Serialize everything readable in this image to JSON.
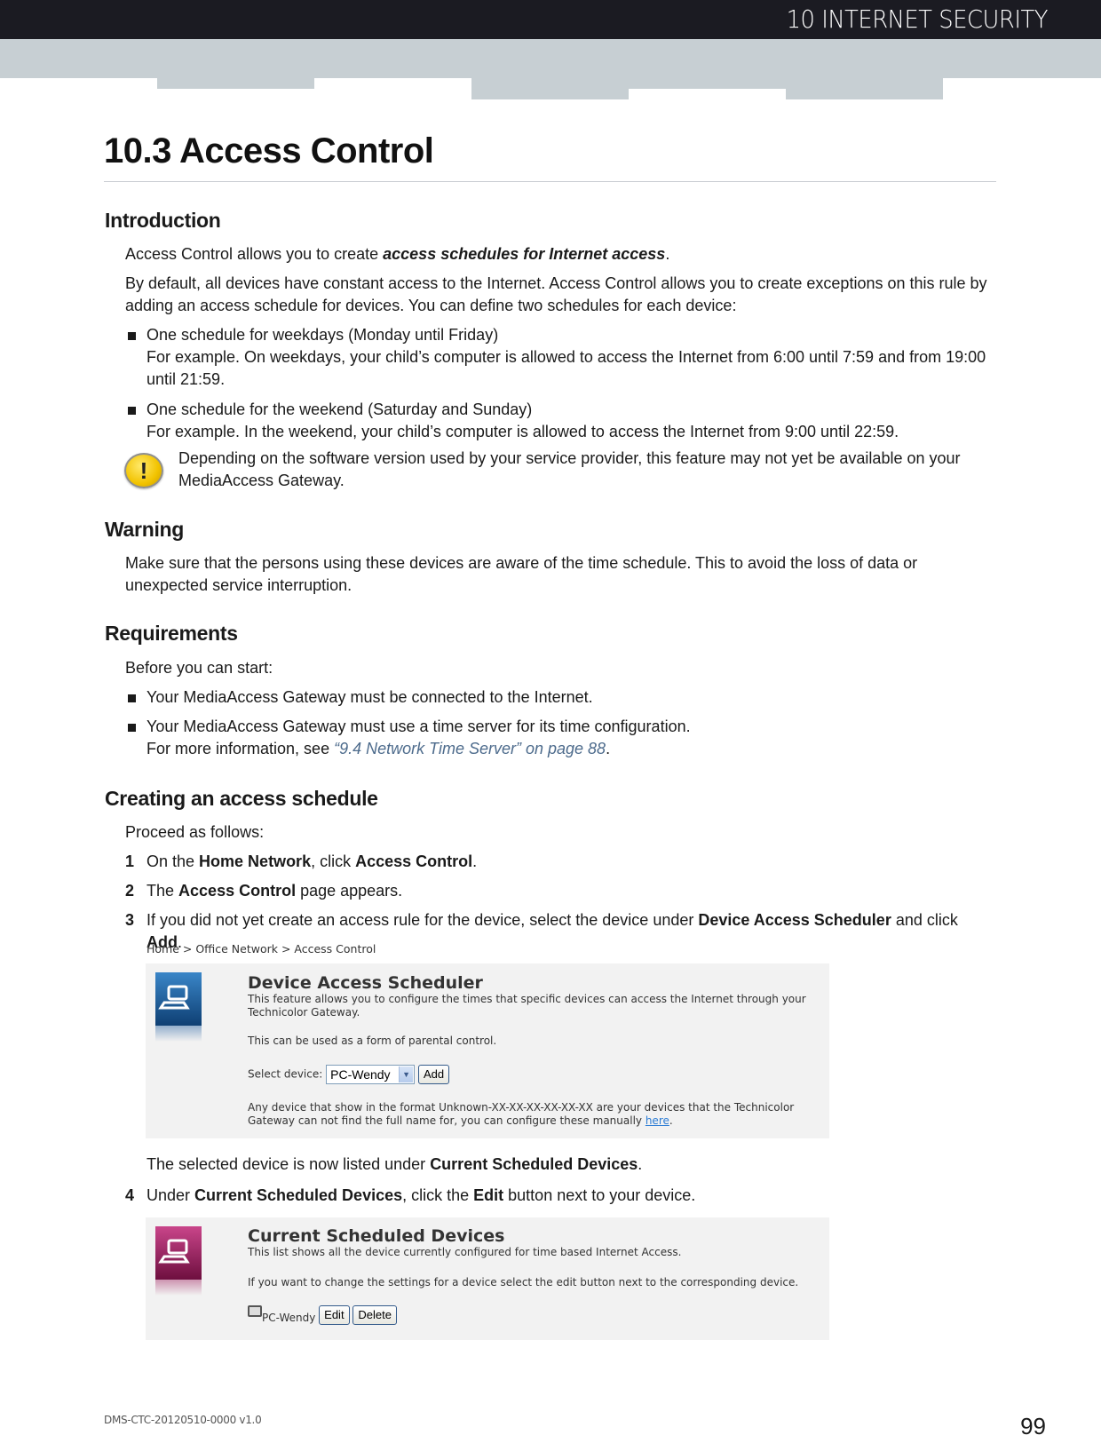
{
  "header": {
    "chapter": "10 INTERNET SECURITY"
  },
  "title": "10.3 Access Control",
  "introduction": {
    "heading": "Introduction",
    "p1_pre": "Access Control allows you to create ",
    "p1_em": "access schedules for Internet access",
    "p1_post": ".",
    "p2": "By default, all devices have constant access to the Internet. Access Control allows you to create exceptions on this rule by adding an access schedule for devices. You can define two schedules for each device:",
    "bullets": [
      {
        "line1": "One schedule for weekdays (Monday until Friday)",
        "line2": "For example. On weekdays, your child’s computer is allowed to access the Internet from 6:00 until 7:59 and from 19:00 until 21:59."
      },
      {
        "line1": "One schedule for the weekend (Saturday and Sunday)",
        "line2": "For example. In the weekend, your child’s computer is allowed to access the Internet from 9:00 until 22:59."
      }
    ],
    "note": "Depending on the software version used by your service provider, this feature may not yet be available on your MediaAccess Gateway.",
    "note_icon": "warning-icon"
  },
  "warning": {
    "heading": "Warning",
    "text": "Make sure that the persons using these devices are aware of the time schedule. This to avoid the loss of data or unexpected service interruption."
  },
  "requirements": {
    "heading": "Requirements",
    "intro": "Before you can start:",
    "bullets": [
      {
        "line1": "Your MediaAccess Gateway must be connected to the Internet."
      },
      {
        "line1": "Your MediaAccess Gateway must use a time server for its time configuration.",
        "line2_pre": "For more information, see ",
        "line2_link": "“9.4 Network Time Server” on page 88",
        "line2_post": "."
      }
    ]
  },
  "creating": {
    "heading": "Creating an access schedule",
    "intro": "Proceed as follows:",
    "steps": [
      {
        "num": "1",
        "a": "On the ",
        "b1": "Home Network",
        "c": ", click ",
        "b2": "Access Control",
        "d": "."
      },
      {
        "num": "2",
        "a": "The ",
        "b1": "Access Control",
        "c": " page appears."
      },
      {
        "num": "3",
        "a": "If you did not yet create an access rule for the device, select the device under ",
        "b1": "Device Access Scheduler",
        "c": " and click ",
        "b2": "Add",
        "d": "."
      },
      {
        "num": "4",
        "a": "Under ",
        "b1": "Current Scheduled Devices",
        "c": ", click the ",
        "b2": "Edit",
        "d": " button next to your device."
      }
    ],
    "after_step3_pre": "The selected device is now listed under ",
    "after_step3_bold": "Current Scheduled Devices",
    "after_step3_post": "."
  },
  "screenshot1": {
    "breadcrumb": "Home > Office Network > Access Control",
    "title": "Device Access Scheduler",
    "desc": "This feature allows you to configure the times that specific devices can access the Internet through your Technicolor Gateway.",
    "parental": "This can be used as a form of parental control.",
    "select_label": "Select device:",
    "select_value": "PC-Wendy",
    "add_button": "Add",
    "unknown_note": "Any device that show in the format Unknown-XX-XX-XX-XX-XX-XX are your devices that the Technicolor Gateway can not find the full name for, you can configure these manually ",
    "here_link": "here",
    "unknown_note_end": ".",
    "icon_color": "#1e5c9e"
  },
  "screenshot2": {
    "title": "Current Scheduled Devices",
    "desc": "This list shows all the device currently configured for time based Internet Access.",
    "hint": "If you want to change the settings for a device select the edit button next to the corresponding device.",
    "device_name": "PC-Wendy",
    "edit_button": "Edit",
    "delete_button": "Delete",
    "icon_color": "#a0205f"
  },
  "footer": {
    "doc_id": "DMS-CTC-20120510-0000 v1.0",
    "page_number": "99"
  }
}
